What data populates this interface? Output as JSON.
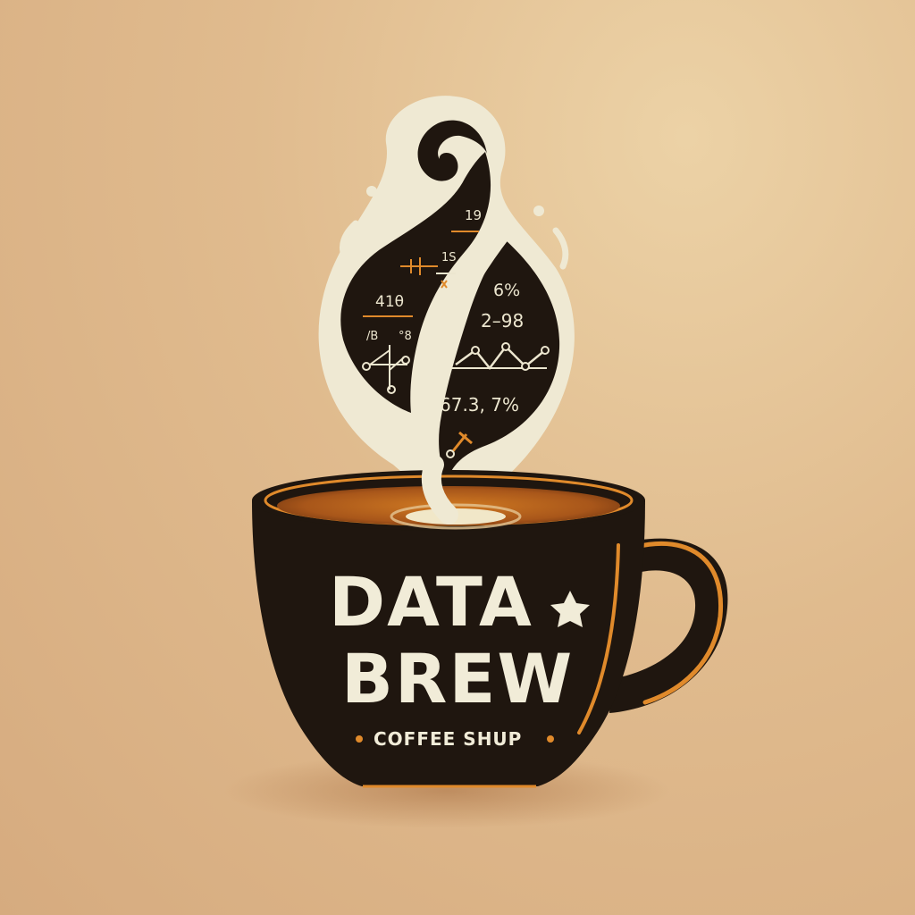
{
  "logo": {
    "line1": "DATA",
    "line2": "BREW",
    "tagline": "COFFEE SHUP"
  },
  "steam_marks": {
    "left": [
      "19",
      "1S",
      "41θ",
      "/B",
      "°8"
    ],
    "right": [
      "6%",
      "2–98",
      "67.3, 7%"
    ]
  },
  "colors": {
    "background": "#e0bb8e",
    "cup": "#1f160f",
    "cream": "#efe9d3",
    "coffee": "#b4611c",
    "accent": "#e08a2b"
  }
}
